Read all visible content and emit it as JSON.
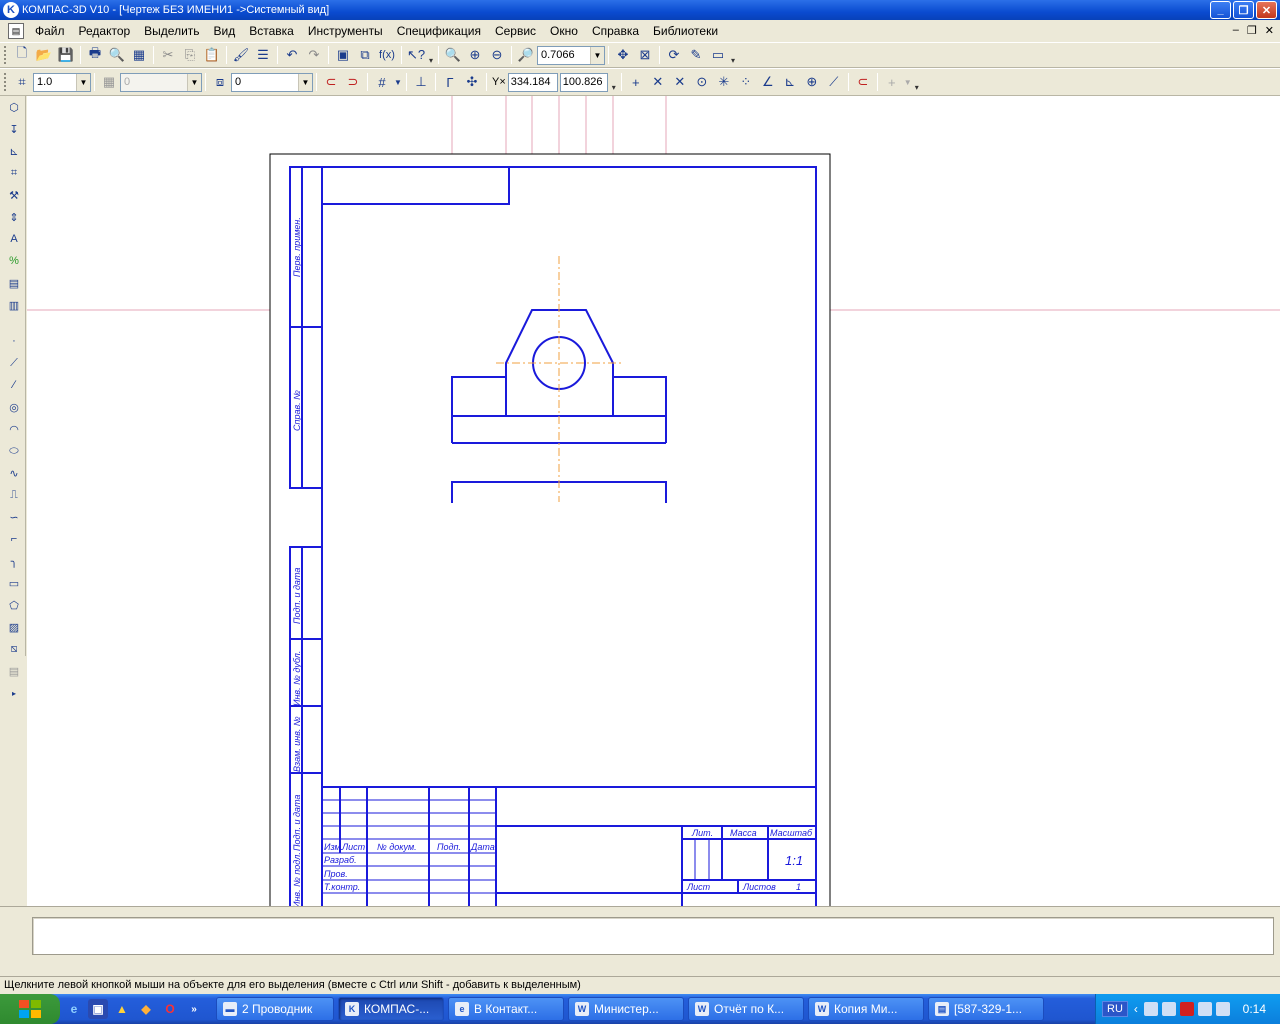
{
  "window": {
    "title": "КОМПАС-3D V10 - [Чертеж БЕЗ ИМЕНИ1 ->Системный вид]",
    "app_icon_letter": "K"
  },
  "menu": {
    "items": [
      {
        "label": "Файл"
      },
      {
        "label": "Редактор"
      },
      {
        "label": "Выделить"
      },
      {
        "label": "Вид"
      },
      {
        "label": "Вставка"
      },
      {
        "label": "Инструменты"
      },
      {
        "label": "Спецификация"
      },
      {
        "label": "Сервис"
      },
      {
        "label": "Окно"
      },
      {
        "label": "Справка"
      },
      {
        "label": "Библиотеки"
      }
    ]
  },
  "toolbar_standard": {
    "zoom_value": "0.7066",
    "fx_label": "f(x)"
  },
  "toolbar_current": {
    "line_scale": "1.0",
    "layer_disabled": "0",
    "layer_state": "0",
    "coord_x": "334.184",
    "coord_y": "100.826",
    "xy_label": "Y×"
  },
  "drawing": {
    "side_labels": [
      "Перв. примен.",
      "Справ. №",
      "Подп. и дата",
      "Инв. № дубл.",
      "Взам. инв. №",
      "Подп. и дата",
      "Инв. № подл."
    ],
    "title_block": {
      "col_headers": [
        "Изм.",
        "Лист",
        "№ докум.",
        "Подп.",
        "Дата"
      ],
      "rows": [
        "Разраб.",
        "Пров.",
        "Т.контр."
      ],
      "lit_label": "Лит.",
      "mass_label": "Масса",
      "scale_label": "Масштаб",
      "scale_value": "1:1",
      "sheet_label": "Лист",
      "sheets_label": "Листов",
      "sheets_value": "1"
    }
  },
  "colors": {
    "drawing_line": "#1a1adb",
    "grid_line": "#e6a7b8",
    "axis_line": "#f0a040",
    "title_bar": "#0a4bd0"
  },
  "status": {
    "hint": "Щелкните левой кнопкой мыши на объекте для его выделения (вместе с Ctrl или Shift - добавить к выделенным)"
  },
  "taskbar": {
    "tasks": [
      {
        "label": "2 Проводник",
        "icon": "folder-icon"
      },
      {
        "label": "КОМПАС-...",
        "icon": "kompas-icon"
      },
      {
        "label": "В Контакт...",
        "icon": "ie-icon"
      },
      {
        "label": "Министер...",
        "icon": "word-icon"
      },
      {
        "label": "Отчёт по К...",
        "icon": "word-icon"
      },
      {
        "label": "Копия Ми...",
        "icon": "word-icon"
      },
      {
        "label": "[587-329-1...",
        "icon": "chat-icon"
      }
    ],
    "lang": "RU",
    "clock": "0:14"
  }
}
